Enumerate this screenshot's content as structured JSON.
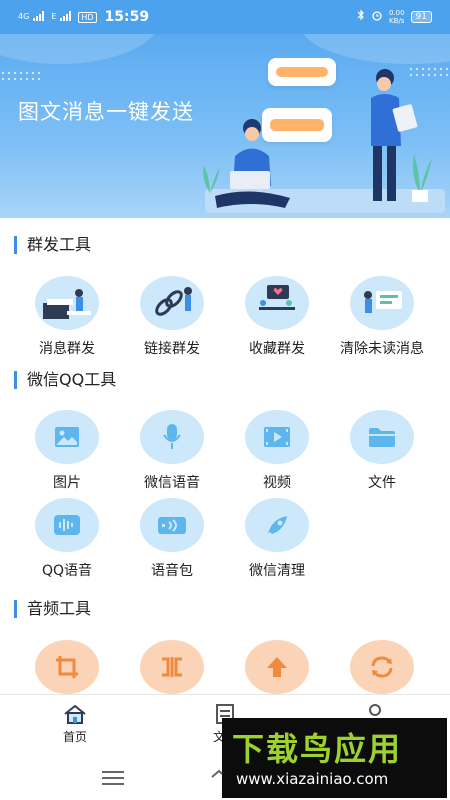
{
  "status_bar": {
    "network": "4G",
    "network2": "E",
    "hd": "HD",
    "time": "15:59",
    "speed_top": "0.00",
    "speed_unit": "KB/s",
    "battery": "91"
  },
  "banner": {
    "title": "图文消息一键发送"
  },
  "sections": [
    {
      "title": "群发工具",
      "items": [
        {
          "label": "消息群发",
          "icon": "message-broadcast-illustration"
        },
        {
          "label": "链接群发",
          "icon": "link-broadcast-illustration"
        },
        {
          "label": "收藏群发",
          "icon": "favorites-broadcast-illustration"
        },
        {
          "label": "清除未读消息",
          "icon": "clear-unread-illustration"
        }
      ]
    },
    {
      "title": "微信QQ工具",
      "items": [
        {
          "label": "图片",
          "icon": "image-icon"
        },
        {
          "label": "微信语音",
          "icon": "microphone-icon"
        },
        {
          "label": "视频",
          "icon": "video-icon"
        },
        {
          "label": "文件",
          "icon": "folder-icon"
        },
        {
          "label": "QQ语音",
          "icon": "voice-wave-icon"
        },
        {
          "label": "语音包",
          "icon": "voice-pack-icon"
        },
        {
          "label": "微信清理",
          "icon": "rocket-icon"
        }
      ]
    },
    {
      "title": "音频工具",
      "items": [
        {
          "icon": "crop-icon"
        },
        {
          "icon": "split-merge-icon"
        },
        {
          "icon": "upload-arrow-icon"
        },
        {
          "icon": "refresh-icon"
        }
      ]
    }
  ],
  "bottom_nav": {
    "home": "首页",
    "docs": "文件"
  },
  "watermark": {
    "title": "下载鸟应用",
    "url": "www.xiazainiao.com"
  },
  "colors": {
    "accent": "#3b8fe6",
    "light_blue": "#cde8fa",
    "orange": "#fbd4b8",
    "icon_orange": "#f08a3c"
  }
}
